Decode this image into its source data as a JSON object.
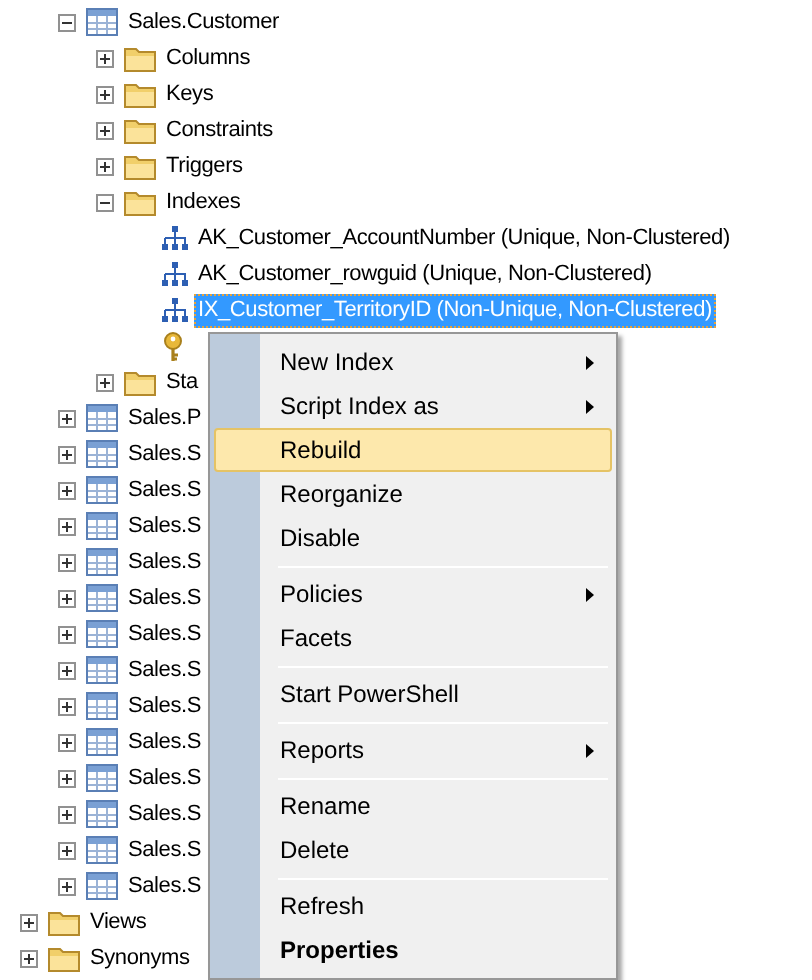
{
  "tree": [
    {
      "kind": "table",
      "label": "Sales.Customer",
      "expanded": true,
      "selected": false,
      "children": [
        {
          "kind": "folder",
          "label": "Columns",
          "expanded": false,
          "selected": false
        },
        {
          "kind": "folder",
          "label": "Keys",
          "expanded": false,
          "selected": false
        },
        {
          "kind": "folder",
          "label": "Constraints",
          "expanded": false,
          "selected": false
        },
        {
          "kind": "folder",
          "label": "Triggers",
          "expanded": false,
          "selected": false
        },
        {
          "kind": "folder",
          "label": "Indexes",
          "expanded": true,
          "selected": false,
          "children": [
            {
              "kind": "index",
              "label": "AK_Customer_AccountNumber (Unique, Non-Clustered)",
              "selected": false
            },
            {
              "kind": "index",
              "label": "AK_Customer_rowguid (Unique, Non-Clustered)",
              "selected": false
            },
            {
              "kind": "index",
              "label": "IX_Customer_TerritoryID (Non-Unique, Non-Clustered)",
              "selected": true
            },
            {
              "kind": "key"
            }
          ]
        },
        {
          "kind": "folder",
          "label": "Sta",
          "expanded": false,
          "selected": false
        }
      ]
    },
    {
      "kind": "table",
      "label": "Sales.P",
      "expanded": false,
      "selected": false
    },
    {
      "kind": "table",
      "label": "Sales.S",
      "expanded": false,
      "selected": false
    },
    {
      "kind": "table",
      "label": "Sales.S",
      "expanded": false,
      "selected": false
    },
    {
      "kind": "table",
      "label": "Sales.S",
      "expanded": false,
      "selected": false
    },
    {
      "kind": "table",
      "label": "Sales.S",
      "expanded": false,
      "selected": false
    },
    {
      "kind": "table",
      "label": "Sales.S",
      "expanded": false,
      "selected": false
    },
    {
      "kind": "table",
      "label": "Sales.S",
      "expanded": false,
      "selected": false
    },
    {
      "kind": "table",
      "label": "Sales.S",
      "expanded": false,
      "selected": false
    },
    {
      "kind": "table",
      "label": "Sales.S",
      "expanded": false,
      "selected": false
    },
    {
      "kind": "table",
      "label": "Sales.S",
      "expanded": false,
      "selected": false
    },
    {
      "kind": "table",
      "label": "Sales.S",
      "expanded": false,
      "selected": false
    },
    {
      "kind": "table",
      "label": "Sales.S",
      "expanded": false,
      "selected": false
    },
    {
      "kind": "table",
      "label": "Sales.S",
      "expanded": false,
      "selected": false
    },
    {
      "kind": "table",
      "label": "Sales.S",
      "expanded": false,
      "selected": false
    }
  ],
  "root_items": [
    {
      "kind": "folder",
      "label": "Views",
      "expanded": false,
      "selected": false
    },
    {
      "kind": "folder",
      "label": "Synonyms",
      "expanded": false,
      "selected": false
    }
  ],
  "context_menu": [
    {
      "kind": "item",
      "label": "New Index",
      "submenu": true,
      "selected": false,
      "default": false
    },
    {
      "kind": "item",
      "label": "Script Index as",
      "submenu": true,
      "selected": false,
      "default": false
    },
    {
      "kind": "item",
      "label": "Rebuild",
      "submenu": false,
      "selected": true,
      "default": false
    },
    {
      "kind": "item",
      "label": "Reorganize",
      "submenu": false,
      "selected": false,
      "default": false
    },
    {
      "kind": "item",
      "label": "Disable",
      "submenu": false,
      "selected": false,
      "default": false
    },
    {
      "kind": "separator"
    },
    {
      "kind": "item",
      "label": "Policies",
      "submenu": true,
      "selected": false,
      "default": false
    },
    {
      "kind": "item",
      "label": "Facets",
      "submenu": false,
      "selected": false,
      "default": false
    },
    {
      "kind": "separator"
    },
    {
      "kind": "item",
      "label": "Start PowerShell",
      "submenu": false,
      "selected": false,
      "default": false
    },
    {
      "kind": "separator"
    },
    {
      "kind": "item",
      "label": "Reports",
      "submenu": true,
      "selected": false,
      "default": false
    },
    {
      "kind": "separator"
    },
    {
      "kind": "item",
      "label": "Rename",
      "submenu": false,
      "selected": false,
      "default": false
    },
    {
      "kind": "item",
      "label": "Delete",
      "submenu": false,
      "selected": false,
      "default": false
    },
    {
      "kind": "separator"
    },
    {
      "kind": "item",
      "label": "Refresh",
      "submenu": false,
      "selected": false,
      "default": false
    },
    {
      "kind": "item",
      "label": "Properties",
      "submenu": false,
      "selected": false,
      "default": true
    }
  ]
}
